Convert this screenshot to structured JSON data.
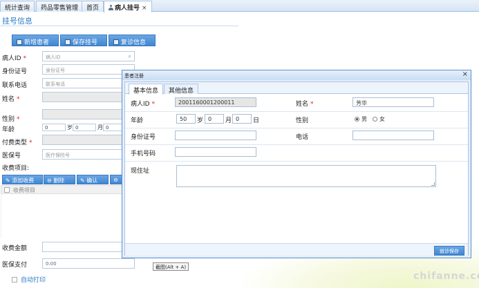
{
  "tabs": [
    {
      "label": "统计查询"
    },
    {
      "label": "药品零售管理"
    },
    {
      "label": "首页"
    },
    {
      "label": "病人挂号",
      "close": "×"
    }
  ],
  "page": {
    "section_title": "挂号信息",
    "toolbar": {
      "new_patient": "新增患者",
      "save_registration": "保存挂号",
      "revisit_info": "复诊信息"
    },
    "fields": {
      "patient_id_label": "病人ID",
      "patient_id_placeholder": "病人ID",
      "id_card_label": "身份证号",
      "id_card_placeholder": "身份证号",
      "phone_label": "联系电话",
      "phone_placeholder": "联系电话",
      "name_label": "姓名",
      "gender_label": "性别",
      "age_label": "年龄",
      "age_year_value": "0",
      "age_year_unit": "岁",
      "age_month_value": "0",
      "age_month_unit": "月",
      "age_day_value": "0",
      "payment_type_label": "付费类型",
      "insurance_no_label": "医保号",
      "insurance_no_placeholder": "医疗保险号",
      "fee_items_label": "收费项目:",
      "fee_amount_label": "收费金额",
      "insurance_pay_label": "医保支付",
      "insurance_pay_value": "0.00",
      "required_mark": "*"
    },
    "fee_toolbar": {
      "add_fee": "添加收费",
      "delete": "删除",
      "confirm": "确认"
    },
    "fee_table": {
      "header": "收费项目"
    },
    "shortcut_button": "截图(Alt + A)",
    "auto_print": "自动打印"
  },
  "dialog": {
    "title": "患者注册",
    "close": "×",
    "tabs": [
      {
        "label": "基本信息"
      },
      {
        "label": "其他信息"
      }
    ],
    "fields": {
      "patient_id_label": "病人ID",
      "patient_id_value": "2001160001200011",
      "name_label": "姓名",
      "name_value": "芳华",
      "age_label": "年龄",
      "age_year_value": "50",
      "age_year_unit": "岁",
      "age_month_value": "0",
      "age_month_unit": "月",
      "age_day_value": "0",
      "age_day_unit": "日",
      "gender_label": "性别",
      "gender_male": "男",
      "gender_female": "女",
      "gender_selected": "男",
      "id_card_label": "身份证号",
      "phone_label": "电话",
      "mobile_label": "手机号码",
      "address_label": "现住址",
      "required_mark": "*"
    },
    "save_button": "就诊保存"
  },
  "watermark": "chifanne.com"
}
